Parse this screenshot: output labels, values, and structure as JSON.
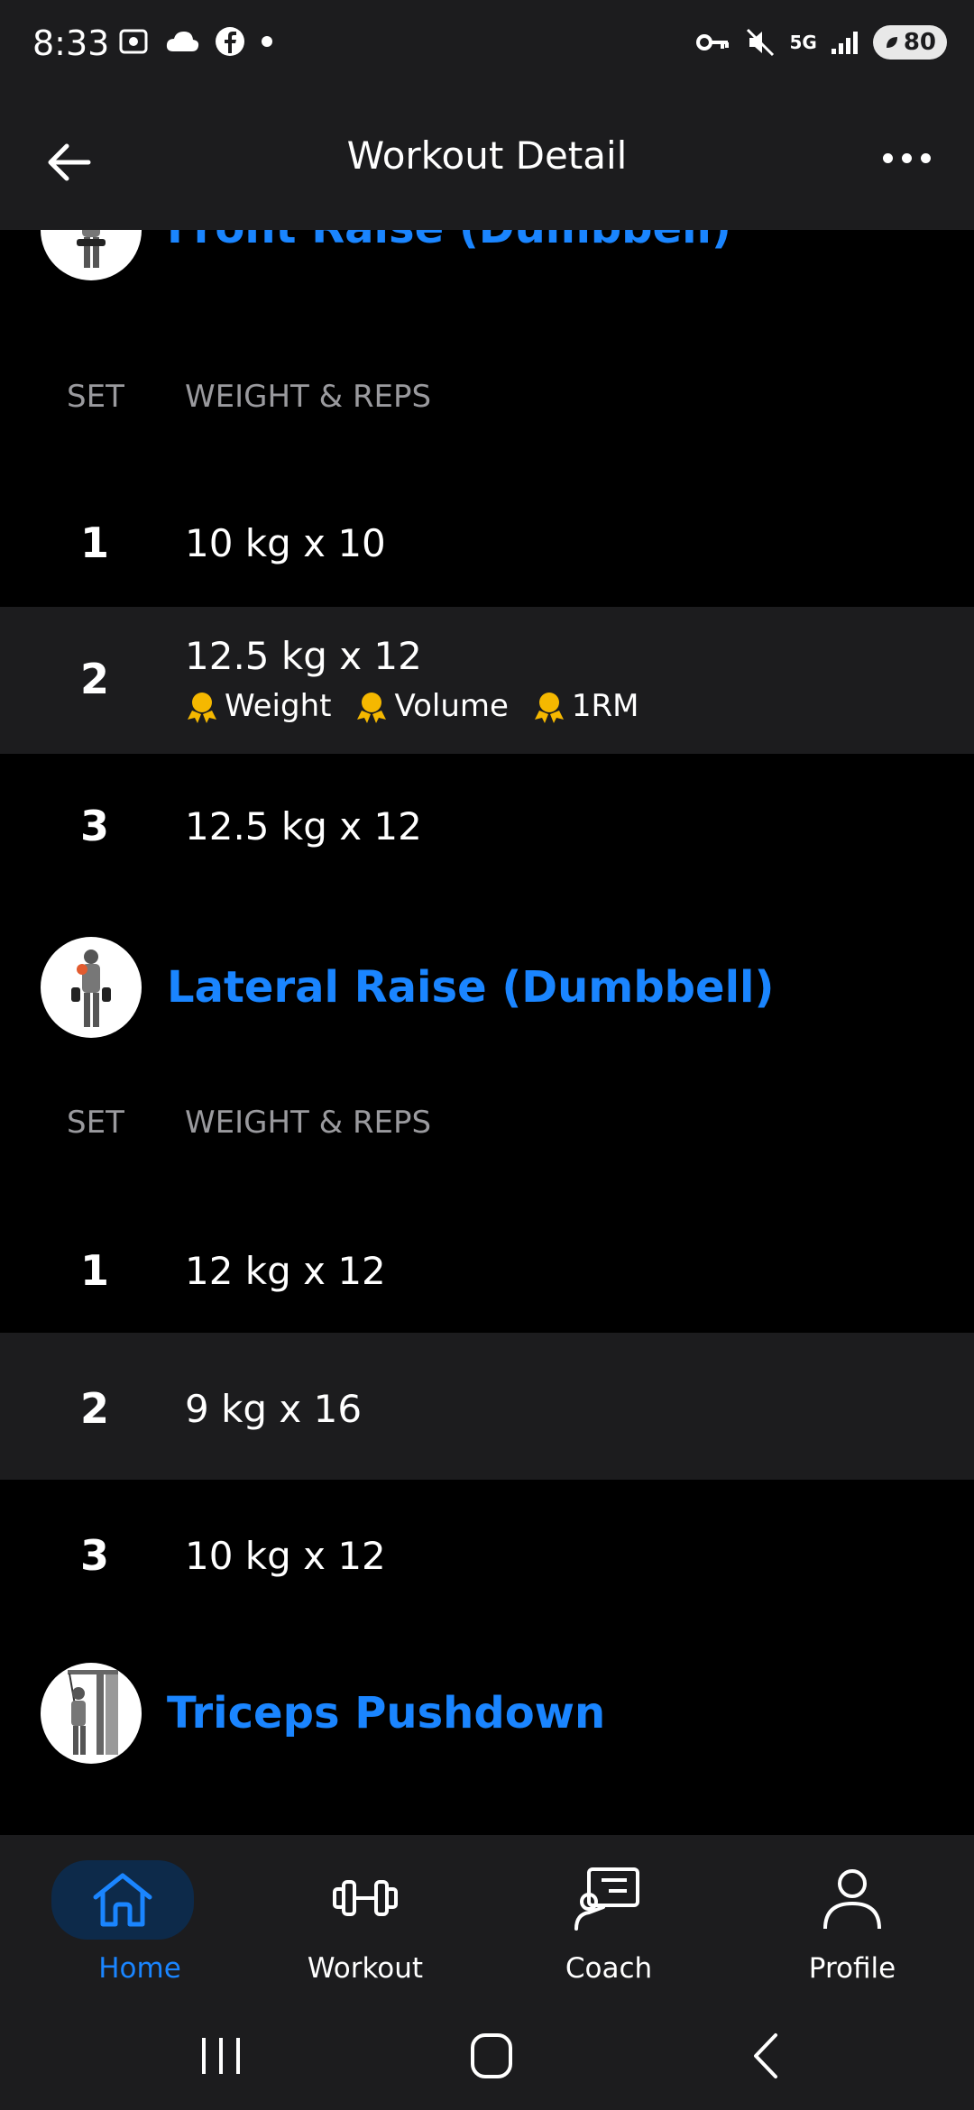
{
  "status_bar": {
    "time": "8:33",
    "battery": "80",
    "network": "5G"
  },
  "app_bar": {
    "title": "Workout Detail",
    "back_icon": "arrow-left-icon",
    "more_icon": "more-horizontal-icon"
  },
  "exercises": [
    {
      "name": "Front Raise (Dumbbell)",
      "header_set": "SET",
      "header_weight_reps": "WEIGHT & REPS",
      "sets": [
        {
          "num": "1",
          "value": "10 kg x 10"
        },
        {
          "num": "2",
          "value": "12.5 kg x 12",
          "prs": [
            "Weight",
            "Volume",
            "1RM"
          ]
        },
        {
          "num": "3",
          "value": "12.5 kg x 12"
        }
      ]
    },
    {
      "name": "Lateral Raise (Dumbbell)",
      "header_set": "SET",
      "header_weight_reps": "WEIGHT & REPS",
      "sets": [
        {
          "num": "1",
          "value": "12 kg x 12"
        },
        {
          "num": "2",
          "value": "9 kg x 16"
        },
        {
          "num": "3",
          "value": "10 kg x 12"
        }
      ]
    },
    {
      "name": "Triceps Pushdown"
    }
  ],
  "bottom_nav": [
    {
      "label": "Home",
      "icon": "home-icon",
      "active": true
    },
    {
      "label": "Workout",
      "icon": "dumbbell-icon",
      "active": false
    },
    {
      "label": "Coach",
      "icon": "coach-icon",
      "active": false
    },
    {
      "label": "Profile",
      "icon": "profile-icon",
      "active": false
    }
  ],
  "colors": {
    "accent": "#1a85ff",
    "pr_medal": "#f5b800",
    "row_alt": "#1c1c1e",
    "background": "#000000"
  }
}
